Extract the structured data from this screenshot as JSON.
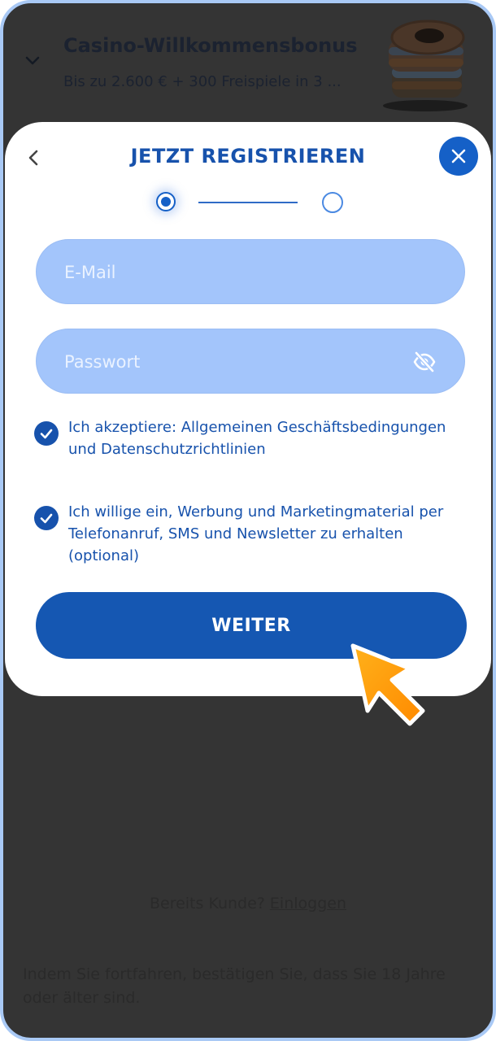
{
  "bonus": {
    "title": "Casino-Willkommensbonus",
    "subtitle": "Bis zu 2.600 € + 300 Freispiele in 3 ..."
  },
  "modal": {
    "title": "JETZT REGISTRIEREN",
    "step_current": 1,
    "step_total": 2
  },
  "form": {
    "email_placeholder": "E-Mail",
    "password_placeholder": "Passwort"
  },
  "consents": [
    {
      "text": "Ich akzeptiere: Allgemeinen Geschäftsbedingungen und Datenschutzrichtlinien",
      "checked": true
    },
    {
      "text": "Ich willige ein, Werbung und Marketingmaterial per Telefonanruf, SMS und Newsletter zu erhalten (optional)",
      "checked": true
    }
  ],
  "continue_label": "WEITER",
  "footer": {
    "existing_customer": "Bereits Kunde?",
    "login_label": "Einloggen",
    "age_notice": "Indem Sie fortfahren, bestätigen Sie, dass Sie 18 Jahre oder älter sind."
  },
  "colors": {
    "primary": "#1557b2",
    "input_bg": "#a3c5fb",
    "overlay": "#343434",
    "pointer": "#ff9a0e"
  },
  "icons": [
    "chevron-down-icon",
    "chevron-left-icon",
    "close-icon",
    "eye-off-icon",
    "checkmark-icon",
    "pointer-hand-icon"
  ]
}
